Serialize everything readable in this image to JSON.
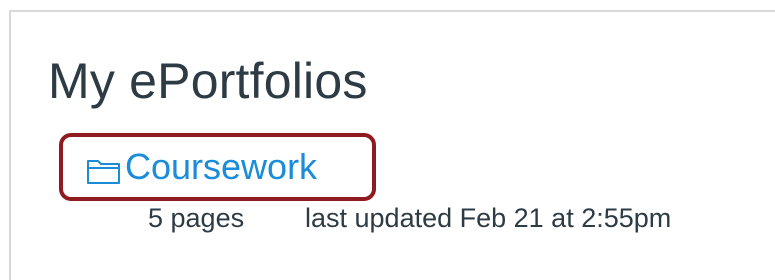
{
  "page": {
    "title": "My ePortfolios"
  },
  "portfolios": [
    {
      "name": "Coursework",
      "icon": "folder-icon",
      "pages": "5 pages",
      "updated": "last updated Feb 21 at 2:55pm"
    }
  ],
  "colors": {
    "link": "#1a8cd8",
    "text": "#2d3b45",
    "highlight": "#8f1a1f",
    "border": "#d9d9d9"
  }
}
